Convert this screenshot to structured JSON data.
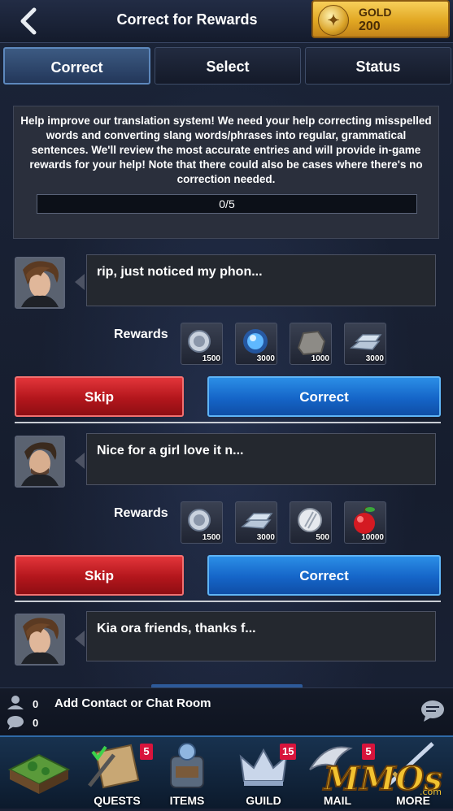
{
  "header": {
    "title": "Correct for Rewards",
    "gold_label": "GOLD",
    "gold_value": "200"
  },
  "tabs": [
    {
      "label": "Correct",
      "active": true
    },
    {
      "label": "Select",
      "active": false
    },
    {
      "label": "Status",
      "active": false
    }
  ],
  "info": {
    "text": "Help improve our translation system! We need your help correcting misspelled words and converting slang words/phrases into regular, grammatical sentences. We'll review the most accurate entries and will provide in-game rewards for your help! Note that there could also be cases where there's no correction needed.",
    "progress_text": "0/5",
    "progress_fraction": 0
  },
  "entries": [
    {
      "message": "rip, just noticed my phon...",
      "rewards_label": "Rewards",
      "rewards": [
        {
          "icon": "silver-coin-icon",
          "count": "1500"
        },
        {
          "icon": "blue-orb-icon",
          "count": "3000"
        },
        {
          "icon": "stone-ore-icon",
          "count": "1000"
        },
        {
          "icon": "silver-ingot-icon",
          "count": "3000"
        }
      ],
      "skip_label": "Skip",
      "correct_label": "Correct"
    },
    {
      "message": "Nice for a girl love it n...",
      "rewards_label": "Rewards",
      "rewards": [
        {
          "icon": "silver-coin-icon",
          "count": "1500"
        },
        {
          "icon": "silver-ingot-icon",
          "count": "3000"
        },
        {
          "icon": "silver-medal-icon",
          "count": "500"
        },
        {
          "icon": "apple-icon",
          "count": "10000"
        }
      ],
      "skip_label": "Skip",
      "correct_label": "Correct"
    },
    {
      "message": "Kia ora friends, thanks f..."
    }
  ],
  "chat": {
    "contacts_count": "0",
    "messages_count": "0",
    "add_label": "Add Contact or Chat Room"
  },
  "nav": [
    {
      "label": "",
      "icon": "world-map-icon"
    },
    {
      "label": "QUESTS",
      "icon": "quest-scroll-icon",
      "badge": "5"
    },
    {
      "label": "ITEMS",
      "icon": "backpack-icon",
      "badge": ""
    },
    {
      "label": "GUILD",
      "icon": "crown-icon",
      "badge": "15"
    },
    {
      "label": "MAIL",
      "icon": "wing-mail-icon",
      "badge": "5"
    },
    {
      "label": "MORE",
      "icon": "sword-icon",
      "badge": ""
    }
  ],
  "watermark": {
    "text": "MMOs",
    "sub": ".com"
  },
  "colors": {
    "skip": "#c2191f",
    "correct": "#1565c8",
    "gold": "#e1a722",
    "badge": "#d8143c"
  }
}
